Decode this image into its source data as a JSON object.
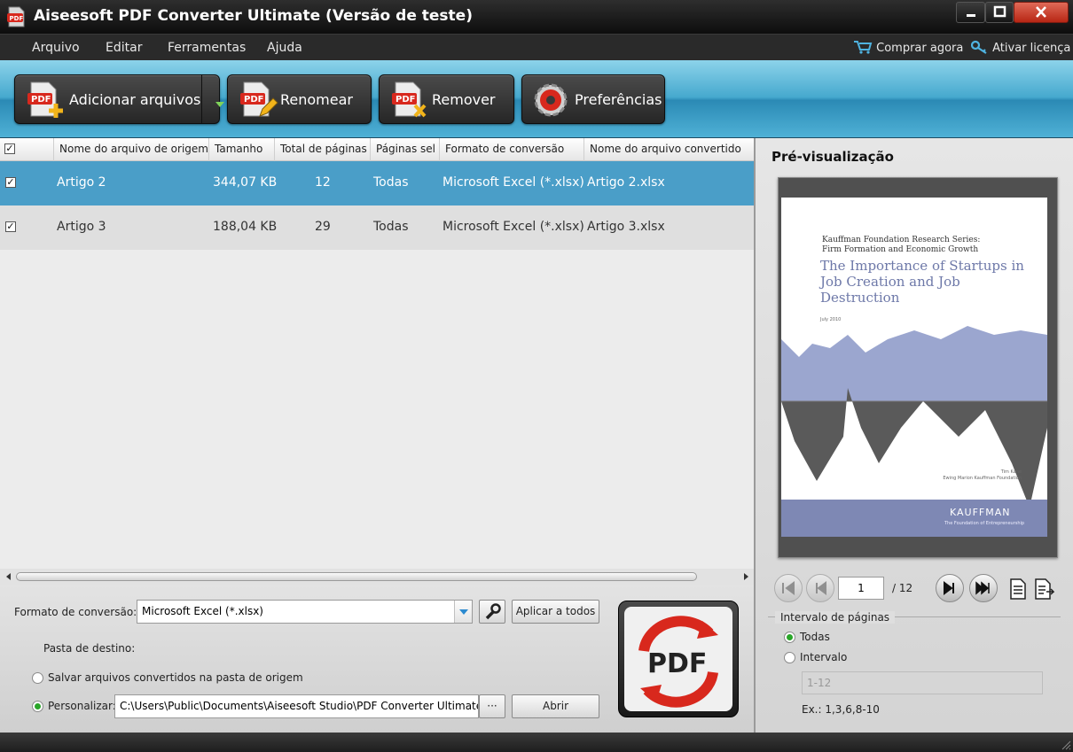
{
  "window": {
    "title": "Aiseesoft PDF Converter Ultimate (Versão de teste)"
  },
  "menu": {
    "items": [
      "Arquivo",
      "Editar",
      "Ferramentas",
      "Ajuda"
    ],
    "buy": "Comprar agora",
    "activate": "Ativar licença"
  },
  "toolbar": {
    "add": "Adicionar arquivos",
    "rename": "Renomear",
    "remove": "Remover",
    "prefs": "Preferências"
  },
  "table": {
    "columns": [
      "Nome do arquivo de origem",
      "Tamanho",
      "Total de páginas",
      "Páginas sel",
      "Formato de conversão",
      "Nome do arquivo convertido"
    ],
    "rows": [
      {
        "name": "Artigo 2",
        "size": "344,07 KB",
        "pages": "12",
        "sel": "Todas",
        "format": "Microsoft Excel (*.xlsx)",
        "output": "Artigo 2.xlsx",
        "checked": true
      },
      {
        "name": "Artigo 3",
        "size": "188,04 KB",
        "pages": "29",
        "sel": "Todas",
        "format": "Microsoft Excel (*.xlsx)",
        "output": "Artigo 3.xlsx",
        "checked": true
      }
    ]
  },
  "settings": {
    "format_label": "Formato de conversão:",
    "format_value": "Microsoft Excel (*.xlsx)",
    "apply_all": "Aplicar a todos",
    "dest_label": "Pasta de destino:",
    "save_source": "Salvar arquivos convertidos na pasta de origem",
    "custom_label": "Personalizar:",
    "custom_path": "C:\\Users\\Public\\Documents\\Aiseesoft Studio\\PDF Converter Ultimate",
    "browse": "···",
    "open": "Abrir",
    "convert_text": "PDF"
  },
  "preview": {
    "title": "Pré-visualização",
    "page_series": "Kauffman Foundation Research Series:",
    "page_series2": "Firm Formation and Economic Growth",
    "page_heading": "The Importance of Startups in Job Creation and Job Destruction",
    "page_date": "July 2010",
    "page_author": "Tim Kane",
    "page_author2": "Ewing Marion Kauffman Foundation",
    "page_brand": "KAUFFMAN",
    "page_tagline": "The Foundation of Entrepreneurship",
    "current_page": "1",
    "total_pages": "/ 12",
    "range_group": "Intervalo de páginas",
    "all": "Todas",
    "interval": "Intervalo",
    "range_placeholder": "1-12",
    "example": "Ex.: 1,3,6,8-10"
  },
  "colors": {
    "accent": "#4a9ec8",
    "toolbar": "#46a9ce",
    "radio_on": "#2aa629"
  }
}
